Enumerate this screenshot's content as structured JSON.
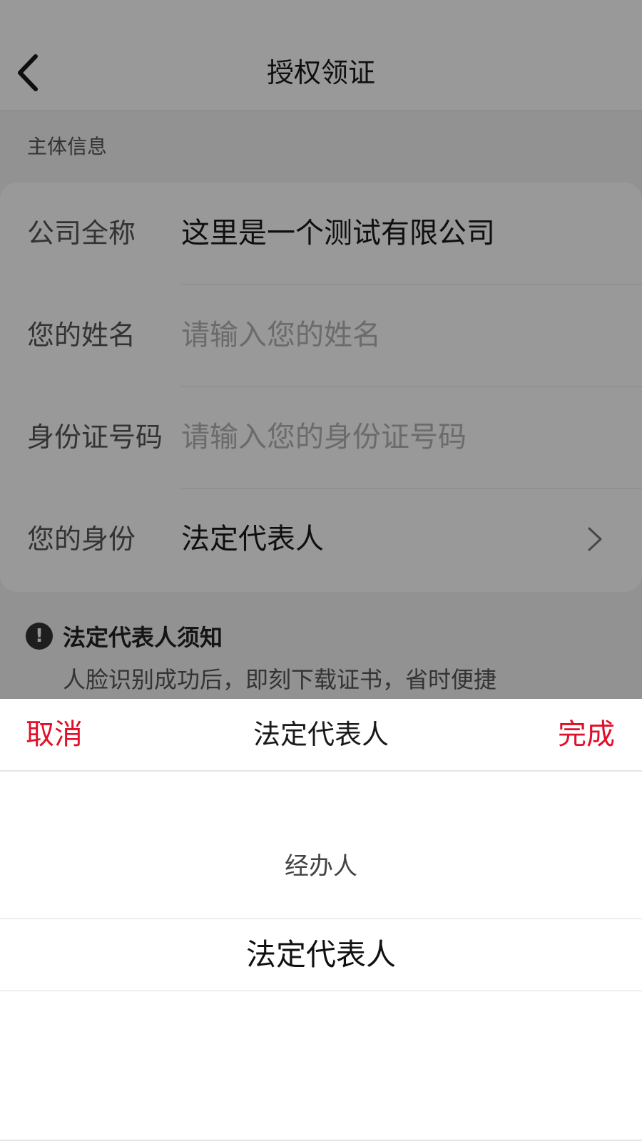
{
  "header": {
    "title": "授权领证"
  },
  "section": {
    "label": "主体信息"
  },
  "form": {
    "company": {
      "label": "公司全称",
      "value": "这里是一个测试有限公司"
    },
    "name": {
      "label": "您的姓名",
      "placeholder": "请输入您的姓名"
    },
    "id_number": {
      "label": "身份证号码",
      "placeholder": "请输入您的身份证号码"
    },
    "identity": {
      "label": "您的身份",
      "value": "法定代表人"
    }
  },
  "notice": {
    "title": "法定代表人须知",
    "text": "人脸识别成功后，即刻下载证书，省时便捷"
  },
  "picker": {
    "cancel_label": "取消",
    "title": "法定代表人",
    "done_label": "完成",
    "options": [
      "经办人",
      "法定代表人"
    ],
    "selected": "法定代表人"
  },
  "colors": {
    "accent": "#e0102a",
    "overlay": "rgba(0,0,0,0.4)"
  }
}
